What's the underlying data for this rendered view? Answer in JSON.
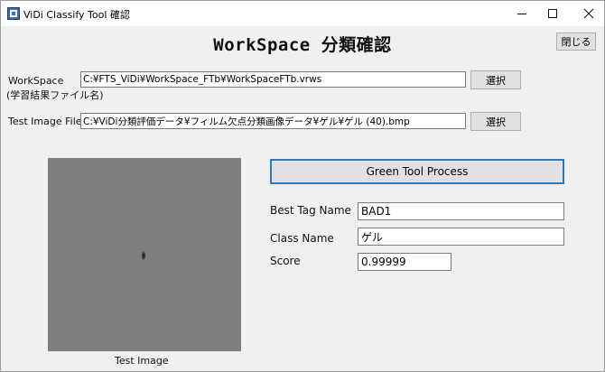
{
  "window": {
    "title": "ViDi Classify Tool 確認",
    "app_icon": "app-icon",
    "controls": {
      "minimize": "minimize-icon",
      "maximize": "maximize-icon",
      "close": "close-icon"
    }
  },
  "heading": "WorkSpace 分類確認",
  "close_button": "閉じる",
  "workspace": {
    "label": "WorkSpace",
    "sublabel": "(学習結果ファイル名)",
    "value": "C:¥FTS_ViDi¥WorkSpace_FTb¥WorkSpaceFTb.vrws",
    "browse": "選択"
  },
  "test_image_file": {
    "label": "Test Image File",
    "value": "C:¥ViDi分類評価データ¥フィルム欠点分類画像データ¥ゲル¥ゲル (40).bmp",
    "browse": "選択"
  },
  "preview": {
    "caption": "Test Image"
  },
  "process_button": "Green Tool Process",
  "results": {
    "best_tag_label": "Best Tag Name",
    "best_tag_value": "BAD1",
    "class_label": "Class Name",
    "class_value": "ゲル",
    "score_label": "Score",
    "score_value": "0.99999"
  }
}
